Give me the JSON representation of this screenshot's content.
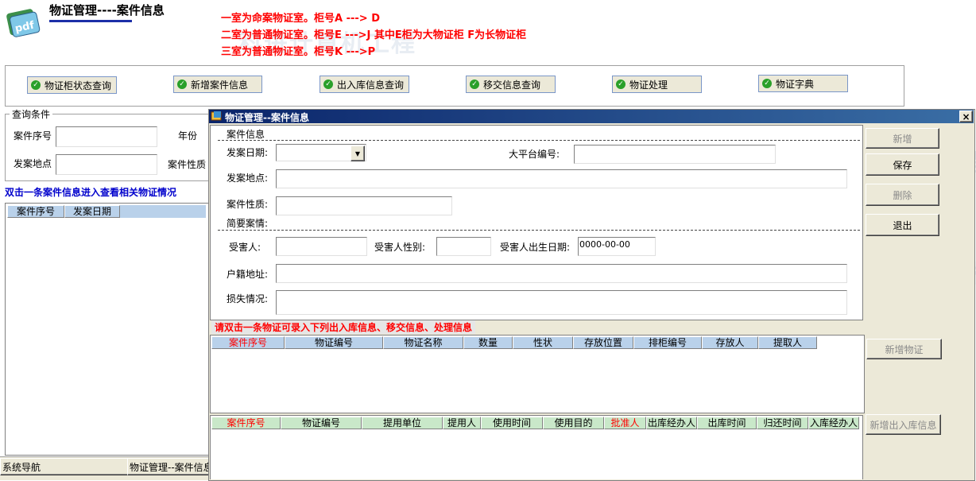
{
  "header": {
    "title": "物证管理----案件信息",
    "notes": [
      "一室为命案物证室。柜号A  ---> D",
      "二室为普通物证室。柜号E  --->J 其中E柜为大物证柜  F为长物证柜",
      "三室为普通物证室。柜号K  --->P"
    ]
  },
  "nav": {
    "buttons": [
      "物证柜状态查询",
      "新增案件信息",
      "出入库信息查询",
      "移交信息查询",
      "物证处理",
      "物证字典"
    ]
  },
  "left_panel": {
    "group_title": "查询条件",
    "case_no_label": "案件序号",
    "year_label": "年份",
    "location_label": "发案地点",
    "nature_label": "案件性质",
    "hint": "双击一条案件信息进入查看相关物证情况",
    "columns": [
      "案件序号",
      "发案日期"
    ]
  },
  "taskbar": {
    "items": [
      "系统导航",
      "物证管理--案件信息"
    ]
  },
  "dialog": {
    "title": "物证管理--案件信息",
    "section_title": "案件信息",
    "fields": {
      "date": "发案日期:",
      "platform_no": "大平台编号:",
      "location": "发案地点:",
      "nature": "案件性质:",
      "summary": "简要案情:",
      "victim": "受害人:",
      "victim_sex": "受害人性别:",
      "victim_birth": "受害人出生日期:",
      "victim_birth_value": "0000-00-00",
      "address": "户籍地址:",
      "loss": "损失情况:"
    },
    "buttons": {
      "add": "新增",
      "save": "保存",
      "delete": "删除",
      "exit": "退出",
      "add_evidence": "新增物证",
      "add_inout": "新增出入库信息"
    },
    "evidence_hint": "请双击一条物证可录入下列出入库信息、移交信息、处理信息",
    "evidence_columns": [
      "案件序号",
      "物证编号",
      "物证名称",
      "数量",
      "性状",
      "存放位置",
      "排柜编号",
      "存放人",
      "提取人"
    ],
    "inout_columns": [
      "案件序号",
      "物证编号",
      "提用单位",
      "提用人",
      "使用时间",
      "使用目的",
      "批准人",
      "出库经办人",
      "出库时间",
      "归还时间",
      "入库经办人"
    ],
    "close_symbol": "×"
  },
  "watermark": "科进计算机工程",
  "colors": {
    "accent_red": "#ff0000",
    "title_bar": "#0a246a",
    "hint_blue": "#0000cc",
    "grid_header_blue": "#b9d1ea",
    "grid_header_green": "#c9e8c9"
  }
}
